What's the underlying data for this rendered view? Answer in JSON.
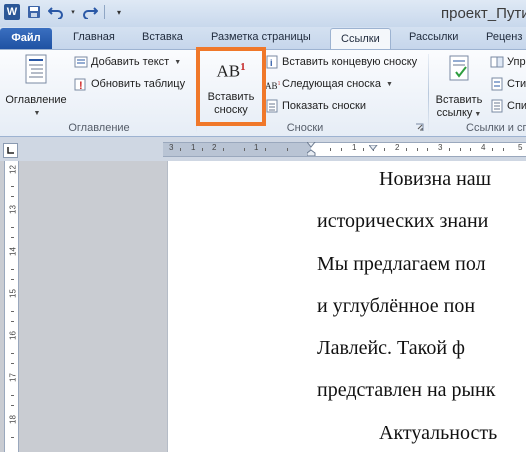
{
  "window": {
    "title": "проект_Пути"
  },
  "quick_access": {
    "app_icon_letter": "W"
  },
  "tabs": [
    {
      "label": "Файл"
    },
    {
      "label": "Главная"
    },
    {
      "label": "Вставка"
    },
    {
      "label": "Разметка страницы"
    },
    {
      "label": "Ссылки"
    },
    {
      "label": "Рассылки"
    },
    {
      "label": "Реценз"
    }
  ],
  "ribbon": {
    "toc_group": {
      "label": "Оглавление",
      "toc_button": "Оглавление",
      "add_text": "Добавить текст",
      "update_table": "Обновить таблицу"
    },
    "footnotes_group": {
      "label": "Сноски",
      "insert_footnote_line1": "Вставить",
      "insert_footnote_line2": "сноску",
      "footnote_icon_text": "AB",
      "footnote_icon_sup": "1",
      "insert_endnote": "Вставить концевую сноску",
      "next_footnote": "Следующая сноска",
      "show_notes": "Показать сноски",
      "endnote_icon_text": "i",
      "next_icon_text": "AB",
      "next_icon_sup": "1"
    },
    "citations_group": {
      "label": "Ссылки и сп",
      "insert_citation_line1": "Вставить",
      "insert_citation_line2": "ссылку",
      "manage_sources": "Упр",
      "style": "Сти",
      "bibliography": "Спи"
    }
  },
  "ruler": {
    "h_numbers": [
      "3",
      "1",
      "2",
      "1",
      "1",
      "2",
      "3",
      "4",
      "5",
      "6"
    ],
    "v_numbers": [
      "12",
      "13",
      "14",
      "15",
      "16",
      "17",
      "18"
    ]
  },
  "document": {
    "lines": [
      "Новизна наш",
      "исторических знани",
      "Мы предлагаем пол",
      "и углублённое пон",
      "Лавлейс. Такой ф",
      "представлен на рынк",
      "Актуальность"
    ]
  }
}
